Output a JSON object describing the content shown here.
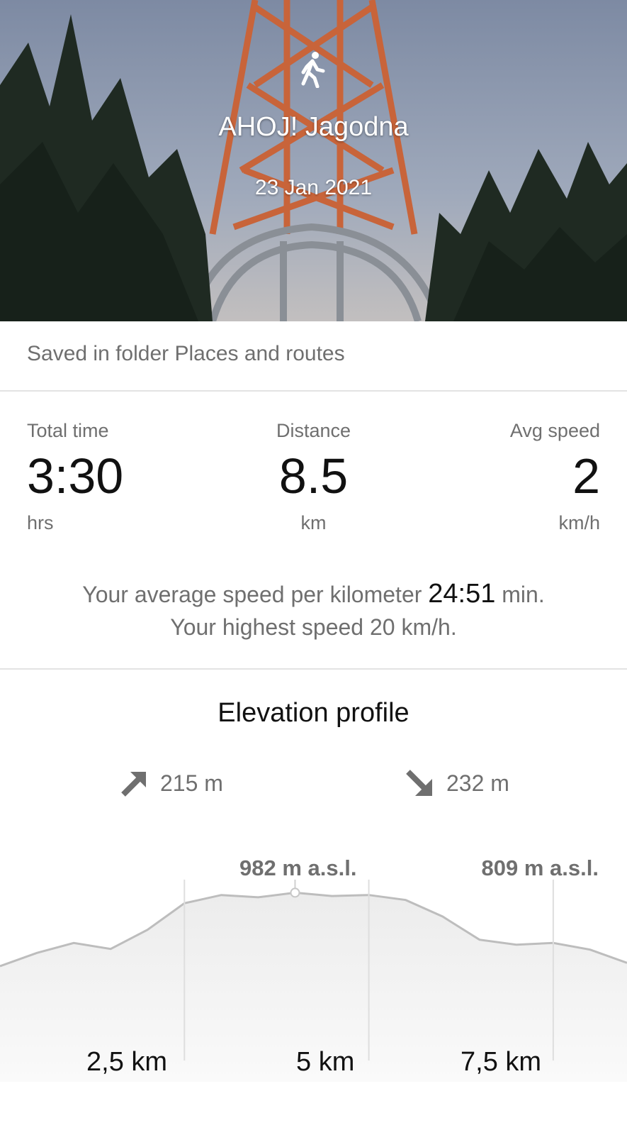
{
  "activity": {
    "icon": "walking-person-icon",
    "title": "AHOJ! Jagodna",
    "date": "23 Jan 2021"
  },
  "folder_text": "Saved in folder Places and routes",
  "stats": {
    "total_time": {
      "label": "Total time",
      "value": "3:30",
      "unit": "hrs"
    },
    "distance": {
      "label": "Distance",
      "value": "8.5",
      "unit": "km"
    },
    "avg_speed": {
      "label": "Avg speed",
      "value": "2",
      "unit": "km/h"
    }
  },
  "speed_info": {
    "line1_prefix": "Your average speed per kilometer",
    "line1_value": "24:51",
    "line1_suffix": "min.",
    "line2": "Your highest speed 20 km/h."
  },
  "elevation": {
    "title": "Elevation profile",
    "ascent": "215 m",
    "descent": "232 m",
    "max_label": "982 m a.s.l.",
    "end_label": "809 m a.s.l.",
    "km_markers": [
      "2,5 km",
      "5 km",
      "7,5 km"
    ]
  },
  "chart_data": {
    "type": "area",
    "x_unit": "km",
    "y_unit": "m a.s.l.",
    "x": [
      0,
      0.5,
      1,
      1.5,
      2,
      2.5,
      3,
      3.5,
      4,
      4.5,
      5,
      5.5,
      6,
      6.5,
      7,
      7.5,
      8,
      8.5
    ],
    "y": [
      760,
      800,
      830,
      812,
      870,
      950,
      975,
      968,
      982,
      972,
      975,
      960,
      910,
      840,
      825,
      830,
      810,
      770
    ],
    "xticks": [
      "2,5 km",
      "5 km",
      "7,5 km"
    ],
    "annotations": [
      "982 m a.s.l.",
      "809 m a.s.l."
    ]
  }
}
